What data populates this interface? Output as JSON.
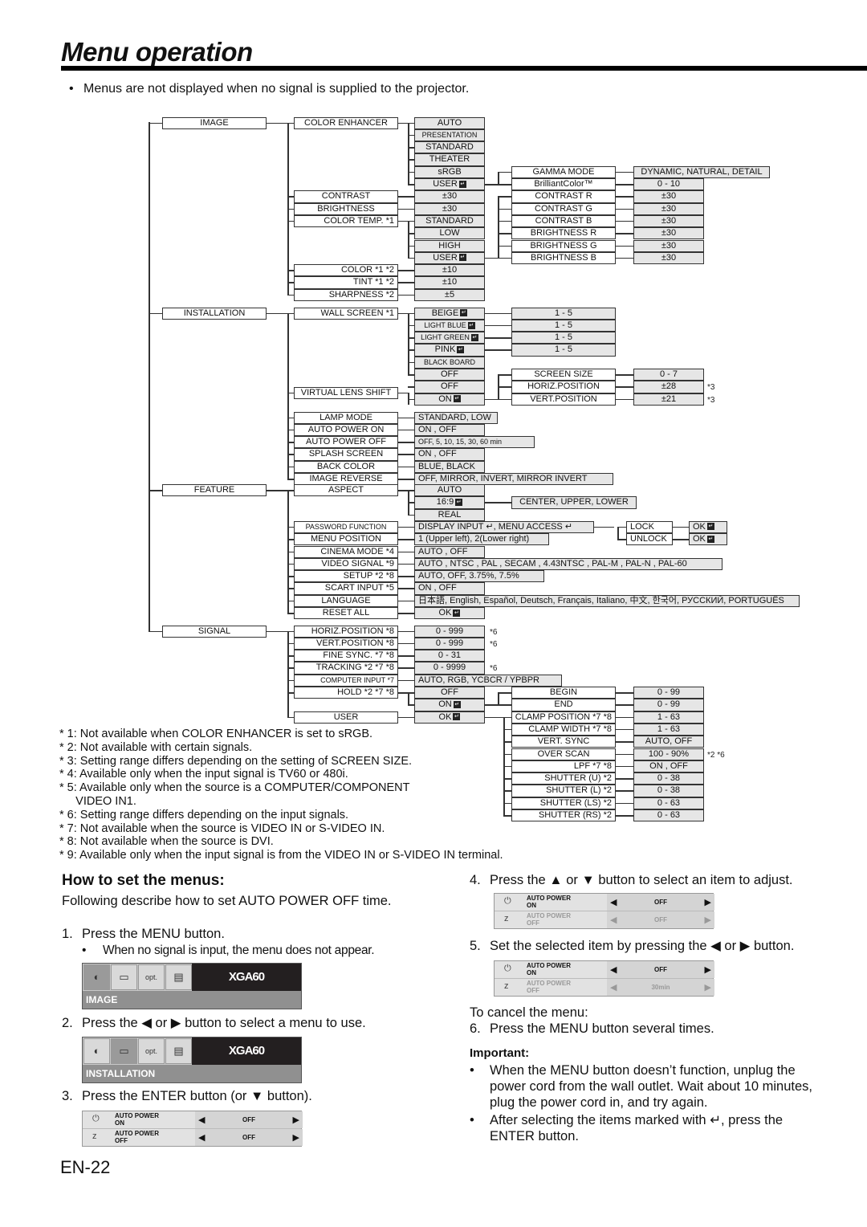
{
  "title": "Menu operation",
  "intro": "Menus are not displayed when no signal is supplied to the projector.",
  "enter_glyph": "↵",
  "tree": {
    "image": {
      "label": "IMAGE",
      "color_enhancer": {
        "label": "COLOR ENHANCER",
        "options": [
          "AUTO",
          "PRESENTATION",
          "STANDARD",
          "THEATER",
          "sRGB",
          "USER"
        ]
      },
      "user_sub": [
        {
          "label": "GAMMA MODE",
          "value": "DYNAMIC, NATURAL, DETAIL"
        },
        {
          "label": "BrilliantColor™",
          "value": "0 - 10"
        }
      ],
      "contrast": {
        "label": "CONTRAST",
        "value": "±30"
      },
      "brightness": {
        "label": "BRIGHTNESS",
        "value": "±30"
      },
      "color_temp": {
        "label": "COLOR TEMP.",
        "note": "*1",
        "options": [
          "STANDARD",
          "LOW",
          "HIGH",
          "USER"
        ]
      },
      "ct_user_sub": [
        {
          "label": "CONTRAST R",
          "value": "±30"
        },
        {
          "label": "CONTRAST G",
          "value": "±30"
        },
        {
          "label": "CONTRAST B",
          "value": "±30"
        },
        {
          "label": "BRIGHTNESS R",
          "value": "±30"
        },
        {
          "label": "BRIGHTNESS G",
          "value": "±30"
        },
        {
          "label": "BRIGHTNESS B",
          "value": "±30"
        }
      ],
      "color": {
        "label": "COLOR",
        "note": "*1 *2",
        "value": "±10"
      },
      "tint": {
        "label": "TINT",
        "note": "*1 *2",
        "value": "±10"
      },
      "sharpness": {
        "label": "SHARPNESS",
        "note": "*2",
        "value": "±5"
      }
    },
    "installation": {
      "label": "INSTALLATION",
      "wall_screen": {
        "label": "WALL SCREEN",
        "note": "*1",
        "options": [
          "BEIGE",
          "LIGHT BLUE",
          "LIGHT GREEN",
          "PINK",
          "BLACK BOARD",
          "OFF"
        ],
        "sub_value": "1 - 5"
      },
      "vls": {
        "label": "VIRTUAL LENS SHIFT",
        "options": [
          "OFF",
          "ON"
        ]
      },
      "vls_sub": [
        {
          "label": "SCREEN SIZE",
          "value": "0 - 7",
          "note": ""
        },
        {
          "label": "HORIZ.POSITION",
          "value": "±28",
          "note": "*3"
        },
        {
          "label": "VERT.POSITION",
          "value": "±21",
          "note": "*3"
        }
      ],
      "items": [
        {
          "label": "LAMP MODE",
          "value": "STANDARD, LOW"
        },
        {
          "label": "AUTO POWER ON",
          "value": "ON , OFF"
        },
        {
          "label": "AUTO POWER OFF",
          "value": "OFF,  5,  10,  15,  30,  60 min"
        },
        {
          "label": "SPLASH SCREEN",
          "value": "ON , OFF"
        },
        {
          "label": "BACK COLOR",
          "value": "BLUE, BLACK"
        },
        {
          "label": "IMAGE REVERSE",
          "value": "OFF, MIRROR, INVERT, MIRROR INVERT"
        }
      ]
    },
    "feature": {
      "label": "FEATURE",
      "aspect": {
        "label": "ASPECT",
        "options": [
          "AUTO",
          "16:9",
          "REAL"
        ],
        "sub_value": "CENTER, UPPER, LOWER"
      },
      "password": {
        "label": "PASSWORD FUNCTION",
        "value": "DISPLAY INPUT ↵, MENU ACCESS ↵",
        "lock": "LOCK",
        "unlock": "UNLOCK",
        "ok": "OK"
      },
      "items": [
        {
          "label": "MENU POSITION",
          "note": "",
          "value": "1 (Upper left), 2(Lower right)"
        },
        {
          "label": "CINEMA MODE",
          "note": "*4",
          "value": "AUTO , OFF"
        },
        {
          "label": "VIDEO SIGNAL",
          "note": "*9",
          "value": "AUTO , NTSC , PAL , SECAM , 4.43NTSC , PAL-M , PAL-N , PAL-60"
        },
        {
          "label": "SETUP",
          "note": "*2 *8",
          "value": "AUTO, OFF, 3.75%, 7.5%"
        },
        {
          "label": "SCART INPUT",
          "note": "*5",
          "value": "ON , OFF"
        },
        {
          "label": "LANGUAGE",
          "note": "",
          "value": "日本語, English, Español, Deutsch, Français, Italiano, 中文, 한국어, РУССКИЙ, PORTUGUÊS"
        },
        {
          "label": "RESET ALL",
          "note": "",
          "value": "OK"
        }
      ]
    },
    "signal": {
      "label": "SIGNAL",
      "items": [
        {
          "label": "HORIZ.POSITION",
          "note": "*8",
          "value": "0 - 999",
          "fn": "*6"
        },
        {
          "label": "VERT.POSITION",
          "note": "*8",
          "value": "0 - 999",
          "fn": "*6"
        },
        {
          "label": "FINE SYNC.",
          "note": "*7 *8",
          "value": "0 - 31",
          "fn": ""
        },
        {
          "label": "TRACKING",
          "note": "*2 *7 *8",
          "value": "0 - 9999",
          "fn": "*6"
        },
        {
          "label": "COMPUTER INPUT",
          "note": "*7",
          "value": "AUTO, RGB, YCBCR / YPBPR",
          "fn": ""
        }
      ],
      "hold": {
        "label": "HOLD",
        "note": "*2 *7 *8",
        "options": [
          "OFF",
          "ON"
        ]
      },
      "user": {
        "label": "USER",
        "value": "OK"
      },
      "hold_sub": [
        {
          "label": "BEGIN",
          "value": "0 - 99"
        },
        {
          "label": "END",
          "value": "0 - 99"
        }
      ],
      "user_sub": [
        {
          "label": "CLAMP POSITION",
          "note": "*7 *8",
          "value": "1 - 63"
        },
        {
          "label": "CLAMP WIDTH",
          "note": "*7 *8",
          "value": "1 - 63"
        },
        {
          "label": "VERT. SYNC",
          "note": "",
          "value": "AUTO, OFF"
        },
        {
          "label": "OVER SCAN",
          "note": "",
          "value": "100 - 90%"
        },
        {
          "label": "LPF",
          "note": "*7 *8",
          "value": "ON , OFF"
        },
        {
          "label": "SHUTTER (U)",
          "note": "*2",
          "value": "0 - 38"
        },
        {
          "label": "SHUTTER (L)",
          "note": "*2",
          "value": "0 - 38"
        },
        {
          "label": "SHUTTER (LS)",
          "note": "*2",
          "value": "0 - 63"
        },
        {
          "label": "SHUTTER (RS)",
          "note": "*2",
          "value": "0 - 63"
        }
      ],
      "overscan_note": "*2 *6"
    }
  },
  "footnotes": [
    "* 1: Not available when COLOR ENHANCER is set to sRGB.",
    "* 2: Not available with certain signals.",
    "* 3: Setting range differs depending on the setting of SCREEN SIZE.",
    "* 4: Available only when the input signal is TV60 or 480i.",
    "* 5: Available only when the source is a COMPUTER/COMPONENT",
    "     VIDEO IN1.",
    "* 6: Setting range differs depending on the input signals.",
    "* 7: Not available when the source is VIDEO IN or S-VIDEO IN.",
    "* 8: Not available when the source is DVI.",
    "* 9: Available only when the input signal is from the VIDEO IN or S-VIDEO IN terminal."
  ],
  "howto": {
    "title": "How to set the menus:",
    "desc": "Following describe how to set AUTO POWER OFF time.",
    "step1": {
      "num": "1.",
      "text": "Press the MENU button.",
      "bullet": "When no signal is input, the menu does not appear."
    },
    "step2": {
      "num": "2.",
      "text": "Press the ◀ or ▶ button to select a menu to use."
    },
    "step3": {
      "num": "3.",
      "text": "Press the ENTER button (or ▼ button)."
    },
    "step4": {
      "num": "4.",
      "text": "Press the ▲ or ▼ button to select an item to adjust."
    },
    "step5": {
      "num": "5.",
      "text": "Set the selected item by pressing the ◀ or ▶ button."
    },
    "cancel": "To cancel the menu:",
    "step6": {
      "num": "6.",
      "text": "Press the MENU button several times."
    },
    "important_title": "Important:",
    "important": [
      "When the MENU button doesn’t function,  unplug the power cord from the wall outlet. Wait about 10 minutes, plug the power cord in, and try again.",
      "After selecting the items marked with ↵, press the ENTER button."
    ],
    "menubar1": {
      "model": "XGA60",
      "tab": "IMAGE",
      "opt": "opt."
    },
    "menubar2": {
      "model": "XGA60",
      "tab": "INSTALLATION",
      "opt": "opt."
    },
    "panel_rows": [
      {
        "label1": "AUTO POWER",
        "label2": "ON"
      },
      {
        "label1": "AUTO POWER",
        "label2": "OFF"
      }
    ],
    "panel3_values": [
      "OFF",
      "OFF"
    ],
    "panel4_values": [
      "OFF",
      "OFF"
    ],
    "panel5_values": [
      "OFF",
      "30min"
    ]
  },
  "page_number": "EN-22"
}
